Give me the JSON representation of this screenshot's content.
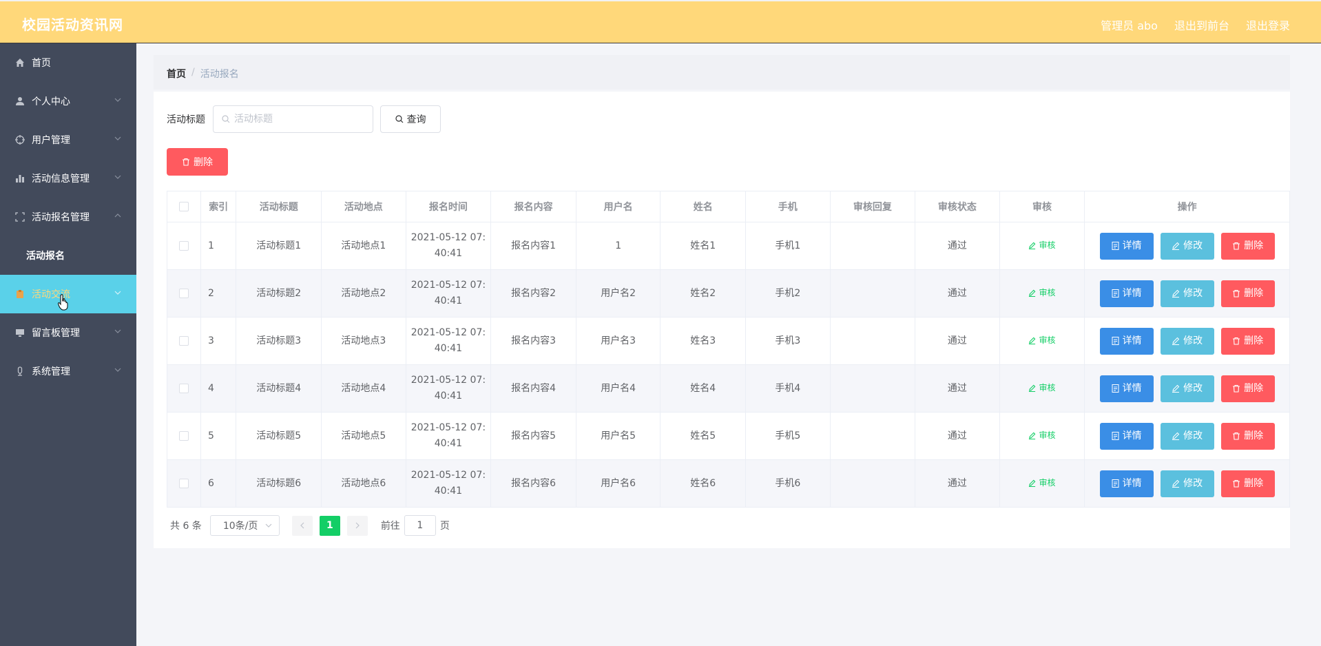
{
  "app": {
    "title": "校园活动资讯网"
  },
  "header": {
    "links": [
      "管理员 abo",
      "退出到前台",
      "退出登录"
    ]
  },
  "sidebar": {
    "items": [
      {
        "label": "首页",
        "icon": "home-icon",
        "has_chevron": false
      },
      {
        "label": "个人中心",
        "icon": "user-icon",
        "has_chevron": true
      },
      {
        "label": "用户管理",
        "icon": "aim-icon",
        "has_chevron": true
      },
      {
        "label": "活动信息管理",
        "icon": "chart-icon",
        "has_chevron": true
      },
      {
        "label": "活动报名管理",
        "icon": "fullscreen-icon",
        "has_chevron": true,
        "expanded": true
      },
      {
        "label": "活动交流",
        "icon": "clipboard-icon",
        "has_chevron": true,
        "active": true
      },
      {
        "label": "留言板管理",
        "icon": "monitor-icon",
        "has_chevron": true
      },
      {
        "label": "系统管理",
        "icon": "mic-icon",
        "has_chevron": true
      }
    ],
    "submenu": [
      "活动报名"
    ]
  },
  "breadcrumb": {
    "home": "首页",
    "separator": "/",
    "current": "活动报名"
  },
  "search": {
    "label": "活动标题",
    "placeholder": "活动标题",
    "value": "",
    "button": "查询"
  },
  "toolbar": {
    "delete_label": "删除"
  },
  "table": {
    "columns": [
      "索引",
      "活动标题",
      "活动地点",
      "报名时间",
      "报名内容",
      "用户名",
      "姓名",
      "手机",
      "审核回复",
      "审核状态",
      "审核",
      "操作"
    ],
    "audit_link": "审核",
    "actions": {
      "detail": "详情",
      "edit": "修改",
      "delete": "删除"
    },
    "rows": [
      {
        "index": "1",
        "title": "活动标题1",
        "place": "活动地点1",
        "time1": "2021-05-12 07:",
        "time2": "40:41",
        "content": "报名内容1",
        "username": "1",
        "name": "姓名1",
        "phone": "手机1",
        "reply": "",
        "status": "通过"
      },
      {
        "index": "2",
        "title": "活动标题2",
        "place": "活动地点2",
        "time1": "2021-05-12 07:",
        "time2": "40:41",
        "content": "报名内容2",
        "username": "用户名2",
        "name": "姓名2",
        "phone": "手机2",
        "reply": "",
        "status": "通过"
      },
      {
        "index": "3",
        "title": "活动标题3",
        "place": "活动地点3",
        "time1": "2021-05-12 07:",
        "time2": "40:41",
        "content": "报名内容3",
        "username": "用户名3",
        "name": "姓名3",
        "phone": "手机3",
        "reply": "",
        "status": "通过"
      },
      {
        "index": "4",
        "title": "活动标题4",
        "place": "活动地点4",
        "time1": "2021-05-12 07:",
        "time2": "40:41",
        "content": "报名内容4",
        "username": "用户名4",
        "name": "姓名4",
        "phone": "手机4",
        "reply": "",
        "status": "通过"
      },
      {
        "index": "5",
        "title": "活动标题5",
        "place": "活动地点5",
        "time1": "2021-05-12 07:",
        "time2": "40:41",
        "content": "报名内容5",
        "username": "用户名5",
        "name": "姓名5",
        "phone": "手机5",
        "reply": "",
        "status": "通过"
      },
      {
        "index": "6",
        "title": "活动标题6",
        "place": "活动地点6",
        "time1": "2021-05-12 07:",
        "time2": "40:41",
        "content": "报名内容6",
        "username": "用户名6",
        "name": "姓名6",
        "phone": "手机6",
        "reply": "",
        "status": "通过"
      }
    ]
  },
  "pagination": {
    "total": "共 6 条",
    "page_size": "10条/页",
    "current_page": "1",
    "goto_label": "前往",
    "goto_value": "1",
    "goto_suffix": "页"
  },
  "colors": {
    "header": "#ffd87a",
    "sidebar": "#424a5b",
    "active_item": "#5ad1e9",
    "detail": "#3a8ee6",
    "edit": "#5bc0de",
    "delete": "#ff5a5f",
    "success": "#13ce66"
  }
}
